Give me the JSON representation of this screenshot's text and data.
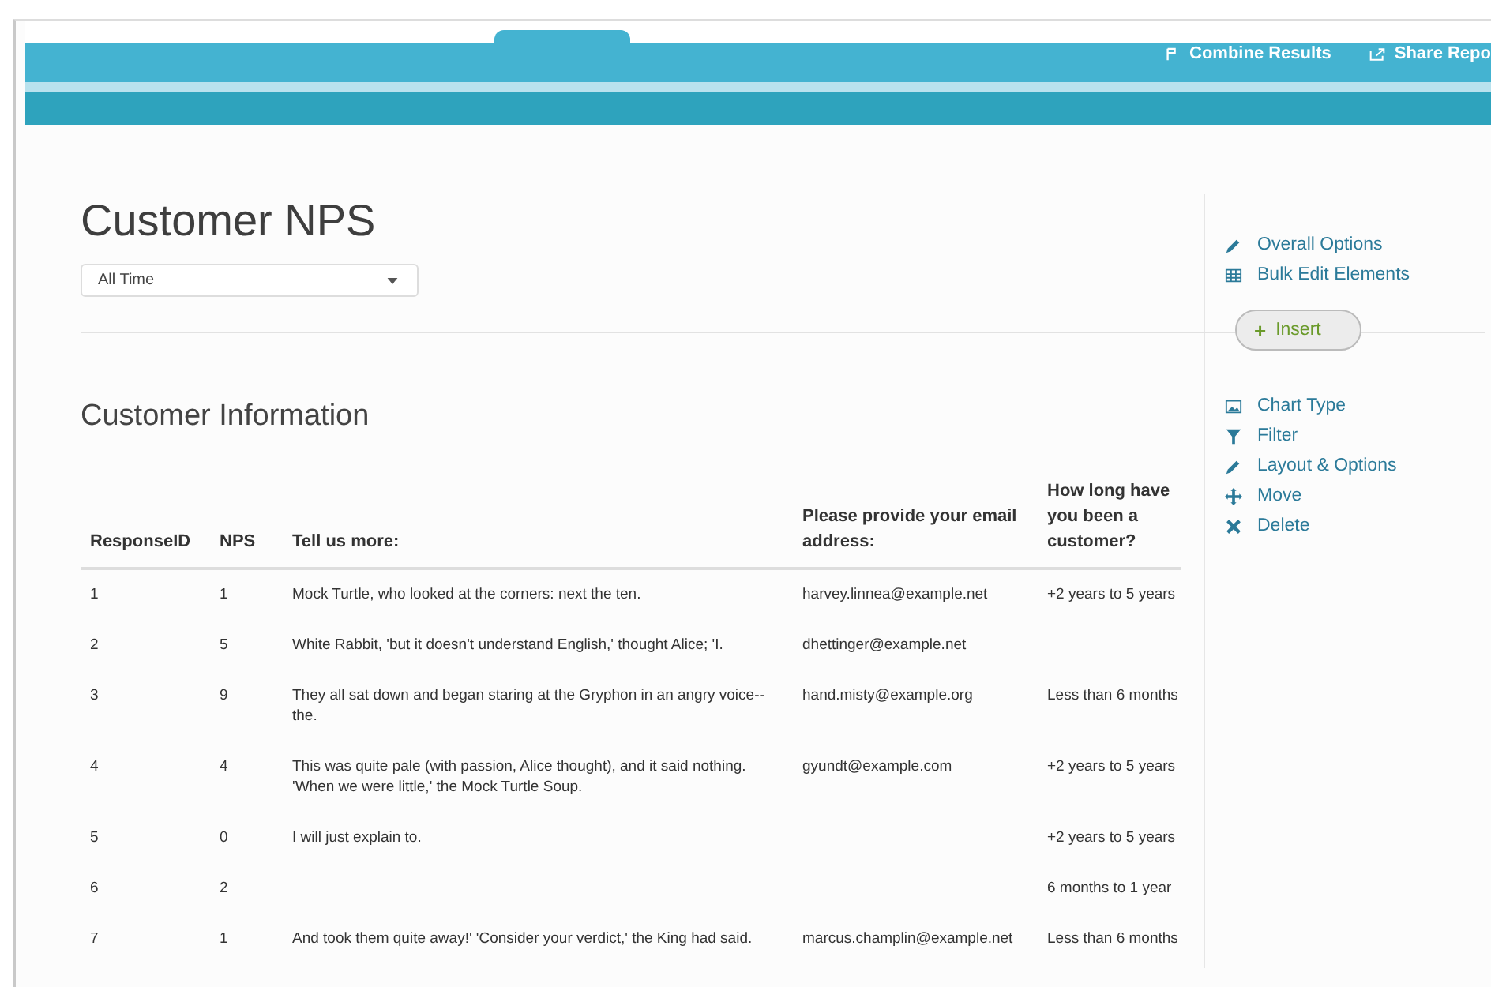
{
  "top_bar": {
    "actions": [
      {
        "label": "Combine Results"
      },
      {
        "label": "Share Repo"
      }
    ]
  },
  "report": {
    "title": "Customer NPS",
    "date_filter": {
      "value": "All Time"
    }
  },
  "side_panel": {
    "report_actions": [
      {
        "label": "Overall Options"
      },
      {
        "label": "Bulk Edit Elements"
      }
    ],
    "insert_button": {
      "label": "+",
      "text": "Insert"
    },
    "element_actions": [
      {
        "label": "Chart Type"
      },
      {
        "label": "Filter"
      },
      {
        "label": "Layout & Options"
      },
      {
        "label": "Move"
      },
      {
        "label": "Delete"
      }
    ]
  },
  "section": {
    "title": "Customer Information",
    "table": {
      "columns": [
        "ResponseID",
        "NPS",
        "Tell us more:",
        "Please provide your email address:",
        "How long have you been a customer?"
      ],
      "rows": [
        [
          "1",
          "1",
          "Mock Turtle, who looked at the corners: next the ten.",
          "harvey.linnea@example.net",
          "+2 years to 5 years"
        ],
        [
          "2",
          "5",
          "White Rabbit, 'but it doesn't understand English,' thought Alice; 'I.",
          "dhettinger@example.net",
          ""
        ],
        [
          "3",
          "9",
          "They all sat down and began staring at the Gryphon in an angry voice--the.",
          "hand.misty@example.org",
          "Less than 6 months"
        ],
        [
          "4",
          "4",
          "This was quite pale (with passion, Alice thought), and it said nothing. 'When we were little,' the Mock Turtle Soup.",
          "gyundt@example.com",
          "+2 years to 5 years"
        ],
        [
          "5",
          "0",
          "I will just explain to.",
          "",
          "+2 years to 5 years"
        ],
        [
          "6",
          "2",
          "",
          "",
          "6 months to 1 year"
        ],
        [
          "7",
          "1",
          "And took them quite away!' 'Consider your verdict,' the King had said.",
          "marcus.champlin@example.net",
          "Less than 6 months"
        ]
      ]
    }
  }
}
